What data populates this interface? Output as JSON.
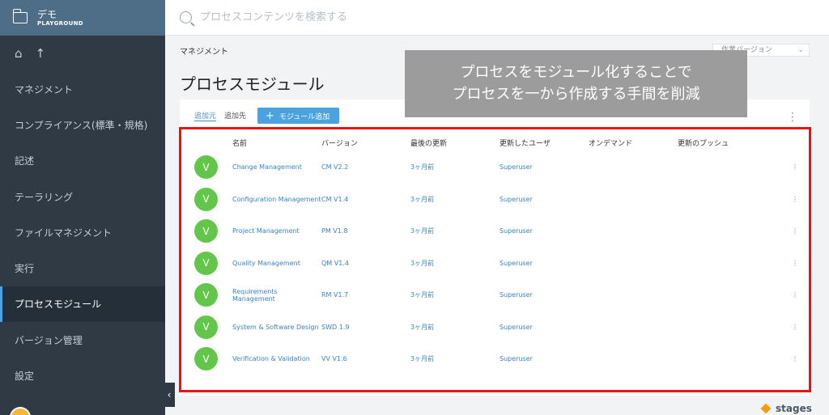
{
  "workspace": {
    "title": "デモ",
    "subtitle": "PLAYGROUND"
  },
  "sidebar": {
    "items": [
      {
        "label": "マネジメント"
      },
      {
        "label": "コンプライアンス(標準・規格)"
      },
      {
        "label": "記述"
      },
      {
        "label": "テーラリング"
      },
      {
        "label": "ファイルマネジメント"
      },
      {
        "label": "実行"
      },
      {
        "label": "プロセスモジュール"
      },
      {
        "label": "バージョン管理"
      },
      {
        "label": "設定"
      }
    ],
    "active_index": 6
  },
  "search": {
    "placeholder": "プロセスコンテンツを検索する"
  },
  "breadcrumb": "マネジメント",
  "page_title": "プロセスモジュール",
  "workspace_select": "作業バージョン",
  "callout": {
    "line1": "プロセスをモジュール化することで",
    "line2": "プロセスを一から作成する手間を削減"
  },
  "tabs": {
    "source": "追加元",
    "target": "追加先"
  },
  "add_button": "モジュール追加",
  "table": {
    "headers": [
      "名前",
      "バージョン",
      "最後の更新",
      "更新したユーザ",
      "オンデマンド",
      "更新のプッシュ"
    ],
    "badge_letter": "V",
    "rows": [
      {
        "name": "Change Management",
        "version": "CM V2.2",
        "updated": "3ヶ月前",
        "user": "Superuser"
      },
      {
        "name": "Configuration Management",
        "version": "CM V1.4",
        "updated": "3ヶ月前",
        "user": "Superuser"
      },
      {
        "name": "Project Management",
        "version": "PM V1.8",
        "updated": "3ヶ月前",
        "user": "Superuser"
      },
      {
        "name": "Quality Management",
        "version": "QM V1.4",
        "updated": "3ヶ月前",
        "user": "Superuser"
      },
      {
        "name": "Requirements Management",
        "version": "RM V1.7",
        "updated": "3ヶ月前",
        "user": "Superuser"
      },
      {
        "name": "System & Software Design",
        "version": "SWD 1.9",
        "updated": "3ヶ月前",
        "user": "Superuser"
      },
      {
        "name": "Verification & Validation",
        "version": "VV V1.6",
        "updated": "3ヶ月前",
        "user": "Superuser"
      }
    ]
  },
  "brand": "stages",
  "colors": {
    "sidebar": "#2f3a45",
    "accent": "#4aa3df",
    "badge": "#63c64a",
    "highlight": "#ee1111"
  }
}
